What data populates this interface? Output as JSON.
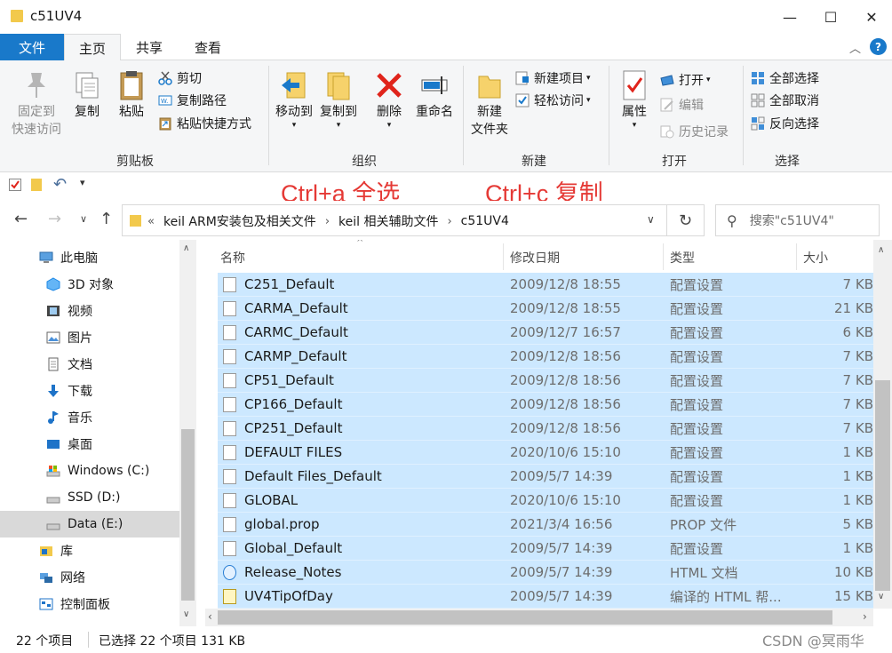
{
  "window": {
    "title": "c51UV4",
    "minimize_glyph": "—",
    "maximize_glyph": "☐",
    "close_glyph": "✕"
  },
  "menu_tabs": [
    "文件",
    "主页",
    "共享",
    "查看"
  ],
  "ribbon": {
    "clipboard": {
      "label": "剪贴板",
      "pin": "固定到\n快速访问",
      "copy": "复制",
      "paste": "粘贴",
      "cut": "剪切",
      "copy_path": "复制路径",
      "paste_shortcut": "粘贴快捷方式"
    },
    "organize": {
      "label": "组织",
      "move_to": "移动到",
      "copy_to": "复制到",
      "delete": "删除",
      "rename": "重命名"
    },
    "new": {
      "label": "新建",
      "new_folder": "新建\n文件夹",
      "new_item": "新建项目",
      "easy_access": "轻松访问"
    },
    "open": {
      "label": "打开",
      "properties": "属性",
      "open": "打开",
      "edit": "编辑",
      "history": "历史记录"
    },
    "select": {
      "label": "选择",
      "select_all": "全部选择",
      "select_none": "全部取消",
      "invert": "反向选择"
    }
  },
  "annotations": {
    "select_all_hint": "Ctrl+a  全选",
    "copy_hint": "Ctrl+c 复制"
  },
  "address": {
    "overflow": "«",
    "crumbs": [
      "keil ARM安装包及相关文件",
      "keil 相关辅助文件",
      "c51UV4"
    ],
    "search_placeholder": "搜索\"c51UV4\""
  },
  "nav_pane": {
    "items": [
      {
        "label": "此电脑",
        "icon": "computer-icon"
      },
      {
        "label": "3D 对象",
        "icon": "3d-objects-icon"
      },
      {
        "label": "视频",
        "icon": "video-icon"
      },
      {
        "label": "图片",
        "icon": "pictures-icon"
      },
      {
        "label": "文档",
        "icon": "documents-icon"
      },
      {
        "label": "下载",
        "icon": "downloads-icon"
      },
      {
        "label": "音乐",
        "icon": "music-icon"
      },
      {
        "label": "桌面",
        "icon": "desktop-icon"
      },
      {
        "label": "Windows (C:)",
        "icon": "drive-icon"
      },
      {
        "label": "SSD (D:)",
        "icon": "drive-icon"
      },
      {
        "label": "Data (E:)",
        "icon": "drive-icon"
      },
      {
        "label": "库",
        "icon": "library-icon"
      },
      {
        "label": "网络",
        "icon": "network-icon"
      },
      {
        "label": "控制面板",
        "icon": "control-panel-icon"
      }
    ]
  },
  "file_list": {
    "columns": [
      "名称",
      "修改日期",
      "类型",
      "大小"
    ],
    "rows": [
      {
        "name": "C251_Default",
        "date": "2009/12/8 18:55",
        "type": "配置设置",
        "size": "7 KB"
      },
      {
        "name": "CARMA_Default",
        "date": "2009/12/8 18:55",
        "type": "配置设置",
        "size": "21 KB"
      },
      {
        "name": "CARMC_Default",
        "date": "2009/12/7 16:57",
        "type": "配置设置",
        "size": "6 KB"
      },
      {
        "name": "CARMP_Default",
        "date": "2009/12/8 18:56",
        "type": "配置设置",
        "size": "7 KB"
      },
      {
        "name": "CP51_Default",
        "date": "2009/12/8 18:56",
        "type": "配置设置",
        "size": "7 KB"
      },
      {
        "name": "CP166_Default",
        "date": "2009/12/8 18:56",
        "type": "配置设置",
        "size": "7 KB"
      },
      {
        "name": "CP251_Default",
        "date": "2009/12/8 18:56",
        "type": "配置设置",
        "size": "7 KB"
      },
      {
        "name": "DEFAULT FILES",
        "date": "2020/10/6 15:10",
        "type": "配置设置",
        "size": "1 KB"
      },
      {
        "name": "Default Files_Default",
        "date": "2009/5/7 14:39",
        "type": "配置设置",
        "size": "1 KB"
      },
      {
        "name": "GLOBAL",
        "date": "2020/10/6 15:10",
        "type": "配置设置",
        "size": "1 KB"
      },
      {
        "name": "global.prop",
        "date": "2021/3/4 16:56",
        "type": "PROP 文件",
        "size": "5 KB"
      },
      {
        "name": "Global_Default",
        "date": "2009/5/7 14:39",
        "type": "配置设置",
        "size": "1 KB"
      },
      {
        "name": "Release_Notes",
        "date": "2009/5/7 14:39",
        "type": "HTML 文档",
        "size": "10 KB"
      },
      {
        "name": "UV4TipOfDay",
        "date": "2009/5/7 14:39",
        "type": "编译的 HTML 帮...",
        "size": "15 KB"
      }
    ]
  },
  "status": {
    "count": "22 个项目",
    "selected": "已选择 22 个项目  131 KB"
  },
  "watermark": "CSDN @冥雨华"
}
